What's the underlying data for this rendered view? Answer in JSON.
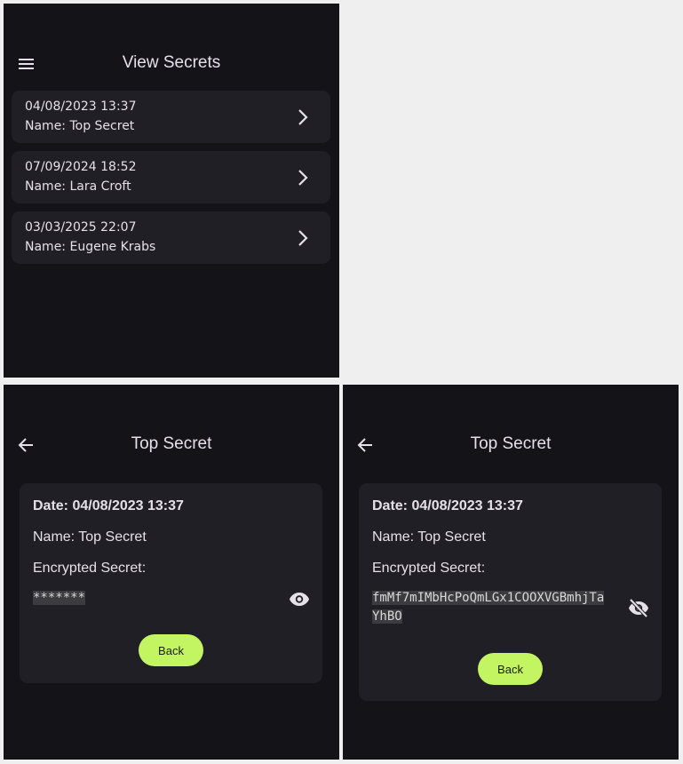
{
  "list_screen": {
    "title": "View Secrets",
    "menu_icon": "menu-icon",
    "items": [
      {
        "date": "04/08/2023 13:37",
        "name": "Name: Top Secret"
      },
      {
        "date": "07/09/2024 18:52",
        "name": "Name: Lara Croft"
      },
      {
        "date": "03/03/2025 22:07",
        "name": "Name: Eugene Krabs"
      }
    ]
  },
  "detail_hidden": {
    "title": "Top Secret",
    "back_icon": "arrow-back-icon",
    "date": "Date: 04/08/2023 13:37",
    "name": "Name: Top Secret",
    "secret_label": "Encrypted Secret:",
    "secret_value": "*******",
    "toggle_icon": "eye-icon",
    "back_button": "Back"
  },
  "detail_shown": {
    "title": "Top Secret",
    "back_icon": "arrow-back-icon",
    "date": "Date: 04/08/2023 13:37",
    "name": "Name: Top Secret",
    "secret_label": "Encrypted Secret:",
    "secret_line1": "fmMf7mIMbHcPoQmLGx1COOXVGBmhjTa",
    "secret_line2": "YhBO",
    "toggle_icon": "eye-off-icon",
    "back_button": "Back"
  },
  "colors": {
    "background": "#141318",
    "surface": "#211f26",
    "text": "#e6e1e9",
    "accent": "#c3f562"
  }
}
